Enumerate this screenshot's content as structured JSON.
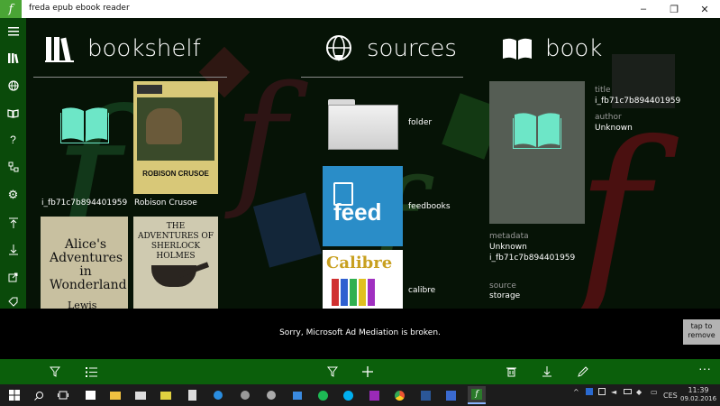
{
  "window": {
    "title": "freda epub ebook reader",
    "app_icon_glyph": "f",
    "minimize": "–",
    "restore": "❐",
    "close": "✕"
  },
  "colors": {
    "accent": "#0b5f0b",
    "sidebar": "#0a4a0a",
    "book_icon": "#6de6c7",
    "tile": "#555d54"
  },
  "sidebar": {
    "items": [
      {
        "name": "hamburger-menu-icon"
      },
      {
        "name": "bookshelf-icon"
      },
      {
        "name": "globe-icon"
      },
      {
        "name": "book-icon"
      },
      {
        "name": "help-icon"
      },
      {
        "name": "sitemap-icon"
      },
      {
        "name": "settings-icon"
      },
      {
        "name": "upload-icon"
      },
      {
        "name": "download-icon"
      },
      {
        "name": "export-icon"
      },
      {
        "name": "tag-icon"
      }
    ]
  },
  "bookshelf": {
    "title": "bookshelf",
    "books": [
      {
        "caption": "i_fb71c7b894401959",
        "type": "placeholder"
      },
      {
        "caption": "Robison Crusoe",
        "type": "cover-crusoe",
        "cover_title": "ROBISON CRUSOE"
      },
      {
        "caption": "",
        "type": "cover-alice",
        "cover_title": "Alice's Adventures in Wonderland",
        "cover_author": "Lewis"
      },
      {
        "caption": "",
        "type": "cover-holmes",
        "cover_title": "THE ADVENTURES OF SHERLOCK HOLMES"
      }
    ]
  },
  "sources": {
    "title": "sources",
    "items": [
      {
        "label": "folder"
      },
      {
        "label": "feedbooks",
        "logo_text": "feed"
      },
      {
        "label": "calibre",
        "logo_text": "Calibre"
      }
    ]
  },
  "book": {
    "title": "book",
    "title_label": "title",
    "title_value": "i_fb71c7b894401959",
    "author_label": "author",
    "author_value": "Unknown",
    "metadata_label": "metadata",
    "metadata_value1": "Unknown",
    "metadata_value2": "i_fb71c7b894401959",
    "source_label": "source",
    "source_value": "storage"
  },
  "ad": {
    "message": "Sorry, Microsoft Ad Mediation is broken.",
    "tap_line1": "tap to",
    "tap_line2": "remove"
  },
  "appbar": {
    "buttons": [
      "filter-icon",
      "list-icon",
      "filter-icon",
      "add-icon",
      "delete-icon",
      "download-icon",
      "edit-icon"
    ],
    "more": "···"
  },
  "taskbar": {
    "lang": "CES",
    "time": "11:39",
    "date": "09.02.2016"
  }
}
